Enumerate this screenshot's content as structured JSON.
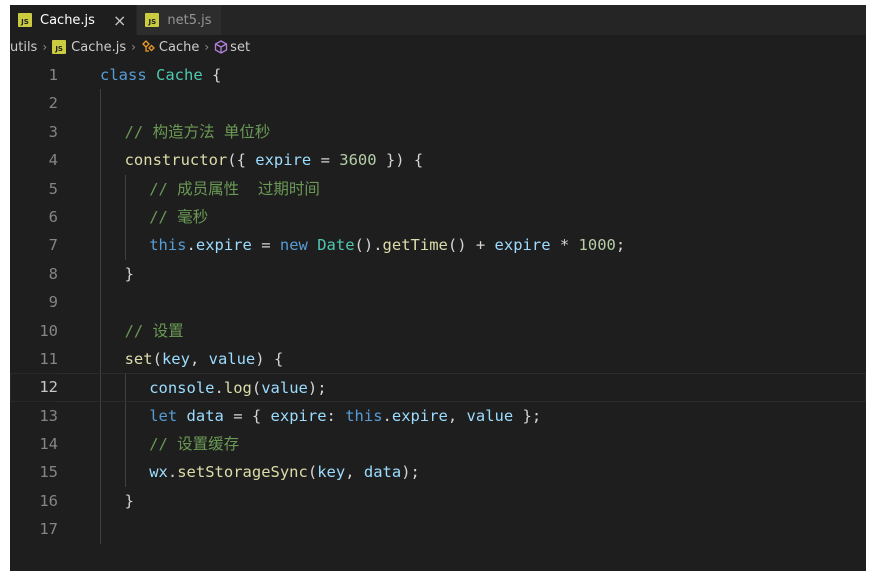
{
  "tabs": [
    {
      "badge": "JS",
      "label": "Cache.js",
      "close": "×",
      "active": true
    },
    {
      "badge": "JS",
      "label": "net5.js",
      "active": false
    }
  ],
  "breadcrumb": {
    "folder": "utils",
    "sep": "›",
    "file_badge": "JS",
    "file": "Cache.js",
    "class_icon": "class-icon",
    "class_name": "Cache",
    "method_icon": "method-icon",
    "method_name": "set"
  },
  "colors": {
    "background": "#1e1e1e",
    "keyword": "#569cd6",
    "class": "#4ec9b0",
    "function": "#dcdcaa",
    "variable": "#9cdcfe",
    "number": "#b5cea8",
    "comment": "#6a9955",
    "js_badge": "#cbcb41"
  },
  "editor": {
    "current_line": 12,
    "lines": [
      {
        "num": "1",
        "indent": 0,
        "tokens": [
          [
            "kw",
            "class"
          ],
          [
            "txt",
            " "
          ],
          [
            "cls",
            "Cache"
          ],
          [
            "txt",
            " {"
          ]
        ]
      },
      {
        "num": "2",
        "indent": 1,
        "tokens": []
      },
      {
        "num": "3",
        "indent": 1,
        "tokens": [
          [
            "cmt",
            "// 构造方法 单位秒"
          ]
        ]
      },
      {
        "num": "4",
        "indent": 1,
        "tokens": [
          [
            "fn",
            "constructor"
          ],
          [
            "txt",
            "({ "
          ],
          [
            "var",
            "expire"
          ],
          [
            "txt",
            " = "
          ],
          [
            "num",
            "3600"
          ],
          [
            "txt",
            " }) {"
          ]
        ]
      },
      {
        "num": "5",
        "indent": 2,
        "tokens": [
          [
            "cmt",
            "// 成员属性  过期时间"
          ]
        ]
      },
      {
        "num": "6",
        "indent": 2,
        "tokens": [
          [
            "cmt",
            "// 毫秒"
          ]
        ]
      },
      {
        "num": "7",
        "indent": 2,
        "tokens": [
          [
            "kw",
            "this"
          ],
          [
            "txt",
            "."
          ],
          [
            "var",
            "expire"
          ],
          [
            "txt",
            " = "
          ],
          [
            "kw",
            "new"
          ],
          [
            "txt",
            " "
          ],
          [
            "cls",
            "Date"
          ],
          [
            "txt",
            "()."
          ],
          [
            "fn",
            "getTime"
          ],
          [
            "txt",
            "() + "
          ],
          [
            "var",
            "expire"
          ],
          [
            "txt",
            " * "
          ],
          [
            "num",
            "1000"
          ],
          [
            "txt",
            ";"
          ]
        ]
      },
      {
        "num": "8",
        "indent": 1,
        "tokens": [
          [
            "txt",
            "}"
          ]
        ]
      },
      {
        "num": "9",
        "indent": 1,
        "tokens": []
      },
      {
        "num": "10",
        "indent": 1,
        "tokens": [
          [
            "cmt",
            "// 设置"
          ]
        ]
      },
      {
        "num": "11",
        "indent": 1,
        "tokens": [
          [
            "fn",
            "set"
          ],
          [
            "txt",
            "("
          ],
          [
            "var",
            "key"
          ],
          [
            "txt",
            ", "
          ],
          [
            "var",
            "value"
          ],
          [
            "txt",
            ") {"
          ]
        ]
      },
      {
        "num": "12",
        "indent": 2,
        "tokens": [
          [
            "var",
            "console"
          ],
          [
            "txt",
            "."
          ],
          [
            "fn",
            "log"
          ],
          [
            "txt",
            "("
          ],
          [
            "var",
            "value"
          ],
          [
            "txt",
            ");"
          ]
        ]
      },
      {
        "num": "13",
        "indent": 2,
        "tokens": [
          [
            "kw",
            "let"
          ],
          [
            "txt",
            " "
          ],
          [
            "var",
            "data"
          ],
          [
            "txt",
            " = { "
          ],
          [
            "var",
            "expire"
          ],
          [
            "txt",
            ": "
          ],
          [
            "kw",
            "this"
          ],
          [
            "txt",
            "."
          ],
          [
            "var",
            "expire"
          ],
          [
            "txt",
            ", "
          ],
          [
            "var",
            "value"
          ],
          [
            "txt",
            " };"
          ]
        ]
      },
      {
        "num": "14",
        "indent": 2,
        "tokens": [
          [
            "cmt",
            "// 设置缓存"
          ]
        ]
      },
      {
        "num": "15",
        "indent": 2,
        "tokens": [
          [
            "var",
            "wx"
          ],
          [
            "txt",
            "."
          ],
          [
            "fn",
            "setStorageSync"
          ],
          [
            "txt",
            "("
          ],
          [
            "var",
            "key"
          ],
          [
            "txt",
            ", "
          ],
          [
            "var",
            "data"
          ],
          [
            "txt",
            ");"
          ]
        ]
      },
      {
        "num": "16",
        "indent": 1,
        "tokens": [
          [
            "txt",
            "}"
          ]
        ]
      },
      {
        "num": "17",
        "indent": 1,
        "tokens": []
      }
    ]
  }
}
